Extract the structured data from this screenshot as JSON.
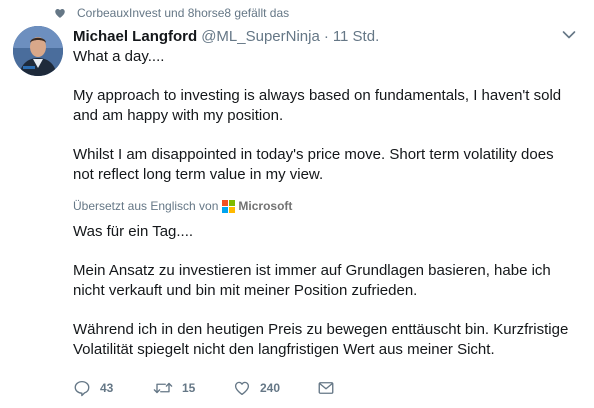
{
  "liked_by": "CorbeauxInvest und 8horse8 gefällt das",
  "author": {
    "name": "Michael Langford",
    "handle": "@ML_SuperNinja",
    "separator": "·",
    "time": "11 Std."
  },
  "tweet": {
    "original": [
      "What a day....",
      "My approach to investing is always based on fundamentals, I haven't sold and am happy with my position.",
      "Whilst I am disappointed in today's price move. Short term volatility does not reflect long term value in my view."
    ],
    "translated_label": "Übersetzt aus Englisch von",
    "translator": "Microsoft",
    "translation": [
      "Was für ein Tag....",
      "Mein Ansatz zu investieren ist immer auf Grundlagen basieren, habe ich nicht verkauft und bin mit meiner Position zufrieden.",
      "Während ich in den heutigen Preis zu bewegen enttäuscht bin. Kurzfristige Volatilität spiegelt nicht den langfristigen Wert aus meiner Sicht."
    ]
  },
  "actions": {
    "replies": "43",
    "retweets": "15",
    "likes": "240"
  },
  "colors": {
    "secondary_text": "#657786",
    "primary_text": "#14171a",
    "ms_red": "#f25022",
    "ms_green": "#7fba00",
    "ms_blue": "#00a4ef",
    "ms_yellow": "#ffb900"
  },
  "icons": {
    "liked": "heart-icon",
    "caret": "chevron-down-icon",
    "reply": "reply-icon",
    "retweet": "retweet-icon",
    "like": "like-icon",
    "dm": "envelope-icon"
  }
}
